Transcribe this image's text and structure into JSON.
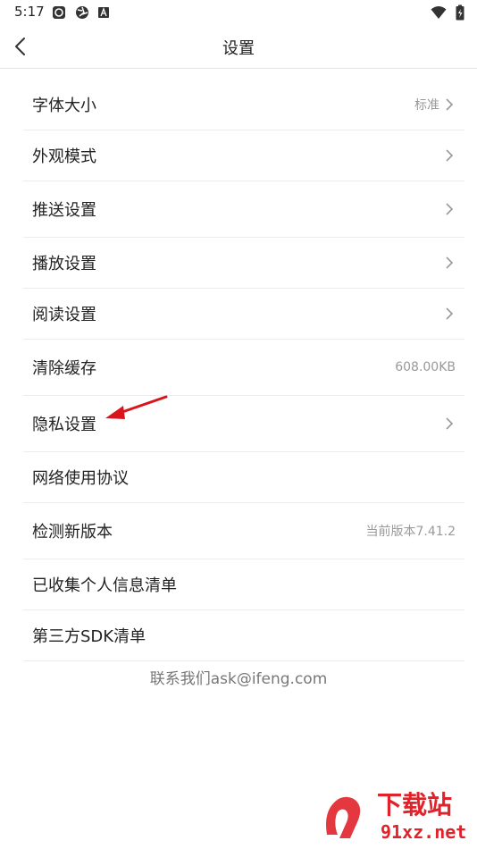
{
  "status_bar": {
    "time": "5:17"
  },
  "header": {
    "title": "设置"
  },
  "settings": [
    {
      "label": "字体大小",
      "value": "标准",
      "arrow": true
    },
    {
      "label": "外观模式",
      "value": "",
      "arrow": true
    },
    {
      "label": "推送设置",
      "value": "",
      "arrow": true
    },
    {
      "label": "播放设置",
      "value": "",
      "arrow": true
    },
    {
      "label": "阅读设置",
      "value": "",
      "arrow": true
    },
    {
      "label": "清除缓存",
      "value": "608.00KB",
      "arrow": false
    },
    {
      "label": "隐私设置",
      "value": "",
      "arrow": true
    },
    {
      "label": "网络使用协议",
      "value": "",
      "arrow": false
    },
    {
      "label": "检测新版本",
      "value": "当前版本7.41.2",
      "arrow": false
    },
    {
      "label": "已收集个人信息清单",
      "value": "",
      "arrow": false
    },
    {
      "label": "第三方SDK清单",
      "value": "",
      "arrow": false
    }
  ],
  "contact_text": "联系我们ask@ifeng.com",
  "watermark": {
    "text_cn": "下载站",
    "text_url": "91xz.net"
  },
  "colors": {
    "annotation_arrow": "#d9141b",
    "watermark": "#e0222a"
  }
}
